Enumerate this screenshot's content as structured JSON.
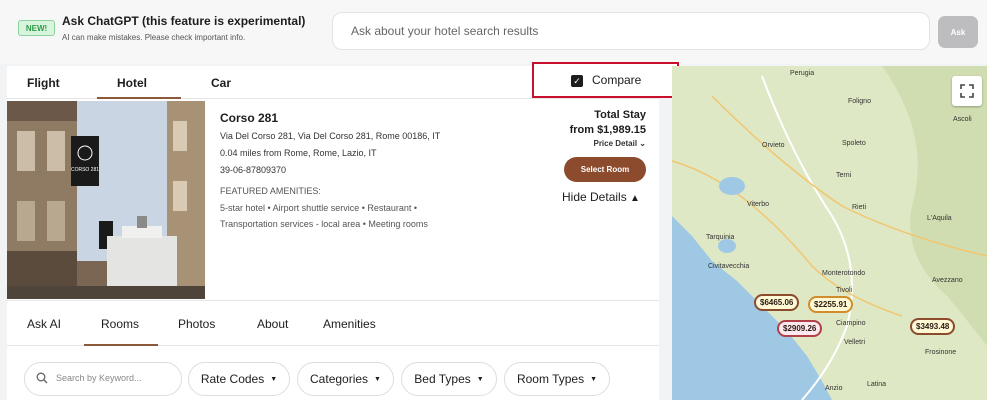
{
  "assistant": {
    "badge": "NEW!",
    "title": "Ask ChatGPT (this feature is experimental)",
    "subtitle": "AI can make mistakes. Please check important info.",
    "input_placeholder": "Ask about your hotel search results",
    "ask_button": "Ask"
  },
  "tabs": {
    "flight": "Flight",
    "hotel": "Hotel",
    "car": "Car"
  },
  "compare": {
    "label": "Compare",
    "checked": true
  },
  "hotel": {
    "name": "Corso 281",
    "address": "Via Del Corso 281, Via Del Corso 281, Rome 00186, IT",
    "distance": "0.04 miles from Rome, Rome, Lazio, IT",
    "phone": "39-06-87809370",
    "amenities_label": "FEATURED AMENITIES:",
    "amenities_line1": "5-star hotel • Airport shuttle service • Restaurant •",
    "amenities_line2": "Transportation services - local area • Meeting rooms",
    "total_label": "Total Stay",
    "price": "from $1,989.15",
    "price_detail": "Price Detail",
    "select_room": "Select Room",
    "hide_details": "Hide Details"
  },
  "subtabs": {
    "ask_ai": "Ask AI",
    "rooms": "Rooms",
    "photos": "Photos",
    "about": "About",
    "amenities": "Amenities"
  },
  "filters": {
    "search_placeholder": "Search by Keyword...",
    "rate_codes": "Rate Codes",
    "categories": "Categories",
    "bed_types": "Bed Types",
    "room_types": "Room Types"
  },
  "map": {
    "places": [
      "Perugia",
      "Foligno",
      "Orvieto",
      "Spoleto",
      "Terni",
      "Viterbo",
      "Rieti",
      "L'Aquila",
      "Tarquinia",
      "Civitavecchia",
      "Monterotondo",
      "Tivoli",
      "Avezzano",
      "Ciampino",
      "Velletri",
      "Frosinone",
      "Anzio",
      "Latina",
      "Ascoli"
    ],
    "prices": [
      "$6465.06",
      "$2255.91",
      "$2909.26",
      "$3493.48"
    ]
  }
}
